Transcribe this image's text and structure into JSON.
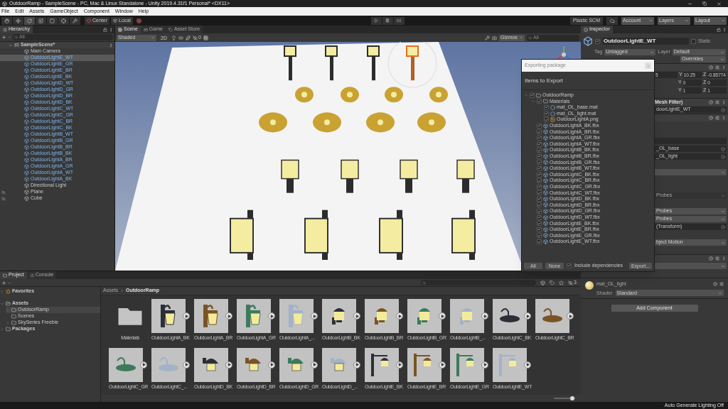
{
  "window": {
    "title": "OutdoorRamp - SampleScene - PC, Mac & Linux Standalone - Unity 2019.4.31f1 Personal* <DX11>"
  },
  "menu": [
    "File",
    "Edit",
    "Assets",
    "GameObject",
    "Component",
    "Window",
    "Help"
  ],
  "toolbar": {
    "pivot": "Center",
    "space": "Local",
    "plastic": "Plastic SCM",
    "account": "Account",
    "layers": "Layers",
    "layout": "Layout"
  },
  "hierarchy": {
    "title": "Hierarchy",
    "search": {
      "placeholder": "All"
    },
    "scene": {
      "label": "SampleScene*",
      "expanded": true
    },
    "items": [
      {
        "label": "Main Camera",
        "kind": "object",
        "selected": false,
        "hidden": false
      },
      {
        "label": "OutdoorLightE_WT",
        "kind": "prefab",
        "selected": true,
        "hidden": false
      },
      {
        "label": "OutdoorLightE_GR",
        "kind": "prefab",
        "selected": false,
        "hidden": false
      },
      {
        "label": "OutdoorLightE_BR",
        "kind": "prefab",
        "selected": false,
        "hidden": false
      },
      {
        "label": "OutdoorLightE_BK",
        "kind": "prefab",
        "selected": false,
        "hidden": false
      },
      {
        "label": "OutdoorLightD_WT",
        "kind": "prefab",
        "selected": false,
        "hidden": false
      },
      {
        "label": "OutdoorLightD_GR",
        "kind": "prefab",
        "selected": false,
        "hidden": false
      },
      {
        "label": "OutdoorLightD_BR",
        "kind": "prefab",
        "selected": false,
        "hidden": false
      },
      {
        "label": "OutdoorLightD_BK",
        "kind": "prefab",
        "selected": false,
        "hidden": false
      },
      {
        "label": "OutdoorLightC_WT",
        "kind": "prefab",
        "selected": false,
        "hidden": false
      },
      {
        "label": "OutdoorLightC_GR",
        "kind": "prefab",
        "selected": false,
        "hidden": false
      },
      {
        "label": "OutdoorLightC_BR",
        "kind": "prefab",
        "selected": false,
        "hidden": false
      },
      {
        "label": "OutdoorLightC_BK",
        "kind": "prefab",
        "selected": false,
        "hidden": false
      },
      {
        "label": "OutdoorLightB_WT",
        "kind": "prefab",
        "selected": false,
        "hidden": false
      },
      {
        "label": "OutdoorLightB_GR",
        "kind": "prefab",
        "selected": false,
        "hidden": false
      },
      {
        "label": "OutdoorLightB_BR",
        "kind": "prefab",
        "selected": false,
        "hidden": false
      },
      {
        "label": "OutdoorLightB_BK",
        "kind": "prefab",
        "selected": false,
        "hidden": false
      },
      {
        "label": "OutdoorLightA_BR",
        "kind": "prefab",
        "selected": false,
        "hidden": false
      },
      {
        "label": "OutdoorLightA_GR",
        "kind": "prefab",
        "selected": false,
        "hidden": false
      },
      {
        "label": "OutdoorLightA_WT",
        "kind": "prefab",
        "selected": false,
        "hidden": false
      },
      {
        "label": "OutdoorLightA_BK",
        "kind": "prefab",
        "selected": false,
        "hidden": false
      },
      {
        "label": "Directional Light",
        "kind": "object",
        "selected": false,
        "hidden": false
      },
      {
        "label": "Plane",
        "kind": "object",
        "selected": false,
        "hidden": true
      },
      {
        "label": "Cube",
        "kind": "object",
        "selected": false,
        "hidden": true
      }
    ]
  },
  "scene_view": {
    "tabs": [
      {
        "label": "Scene",
        "selected": true
      },
      {
        "label": "Game",
        "selected": false
      },
      {
        "label": "Asset Store",
        "selected": false
      }
    ],
    "shading": "Shaded",
    "mode_2d": "2D",
    "hidden_count": "0",
    "gizmos": "Gizmos",
    "search": {
      "placeholder": "All"
    }
  },
  "export_dialog": {
    "title": "Exporting package",
    "heading": "Items to Export",
    "tree": [
      {
        "label": "OutdoorRamp",
        "kind": "folder",
        "checked": true,
        "expanded": true,
        "children": [
          {
            "label": "Materials",
            "kind": "folder",
            "checked": true,
            "expanded": true,
            "children": [
              {
                "label": "mat_OL_base.mat",
                "kind": "material",
                "checked": true
              },
              {
                "label": "mat_OL_light.mat",
                "kind": "material",
                "checked": true
              },
              {
                "label": "OutdoorLightA.png",
                "kind": "texture",
                "checked": true
              }
            ]
          },
          {
            "label": "OutdoorLightA_BK.fbx",
            "kind": "model",
            "checked": true
          },
          {
            "label": "OutdoorLightA_BR.fbx",
            "kind": "model",
            "checked": true
          },
          {
            "label": "OutdoorLightA_GR.fbx",
            "kind": "model",
            "checked": true
          },
          {
            "label": "OutdoorLightA_WT.fbx",
            "kind": "model",
            "checked": true
          },
          {
            "label": "OutdoorLightB_BK.fbx",
            "kind": "model",
            "checked": true
          },
          {
            "label": "OutdoorLightB_BR.fbx",
            "kind": "model",
            "checked": true
          },
          {
            "label": "OutdoorLightB_GR.fbx",
            "kind": "model",
            "checked": true
          },
          {
            "label": "OutdoorLightB_WT.fbx",
            "kind": "model",
            "checked": true
          },
          {
            "label": "OutdoorLightC_BK.fbx",
            "kind": "model",
            "checked": true
          },
          {
            "label": "OutdoorLightC_BR.fbx",
            "kind": "model",
            "checked": true
          },
          {
            "label": "OutdoorLightC_GR.fbx",
            "kind": "model",
            "checked": true
          },
          {
            "label": "OutdoorLightC_WT.fbx",
            "kind": "model",
            "checked": true
          },
          {
            "label": "OutdoorLightD_BK.fbx",
            "kind": "model",
            "checked": true
          },
          {
            "label": "OutdoorLightD_BR.fbx",
            "kind": "model",
            "checked": true
          },
          {
            "label": "OutdoorLightD_GR.fbx",
            "kind": "model",
            "checked": true
          },
          {
            "label": "OutdoorLightD_WT.fbx",
            "kind": "model",
            "checked": true
          },
          {
            "label": "OutdoorLightE_BK.fbx",
            "kind": "model",
            "checked": true
          },
          {
            "label": "OutdoorLightE_BR.fbx",
            "kind": "model",
            "checked": true
          },
          {
            "label": "OutdoorLightE_GR.fbx",
            "kind": "model",
            "checked": true
          },
          {
            "label": "OutdoorLightE_WT.fbx",
            "kind": "model",
            "checked": true
          }
        ]
      }
    ],
    "all": "All",
    "none": "None",
    "include_dependencies": {
      "label": "Include dependencies",
      "checked": true
    },
    "export": "Export..."
  },
  "inspector": {
    "title": "Inspector",
    "object": {
      "name": "OutdoorLightE_WT",
      "active": true,
      "static_label": "Static",
      "static": false
    },
    "tag_label": "Tag",
    "tag": "Untagged",
    "layer_label": "Layer",
    "layer": "Default",
    "overrides": "Overrides",
    "transform": [
      [
        {
          "value": "5"
        },
        {
          "label": "Y",
          "value": "10.25"
        },
        {
          "label": "Z",
          "value": "-0.85774"
        }
      ],
      [
        {
          "label": "Y",
          "value": "0"
        },
        {
          "label": "Z",
          "value": "0"
        }
      ],
      [
        {
          "label": "Y",
          "value": "1"
        },
        {
          "label": "Z",
          "value": "1"
        }
      ]
    ],
    "rows": [
      {
        "kind": "header",
        "text": "Mesh Filter)"
      },
      {
        "kind": "object",
        "text": "doorLightE_WT"
      },
      {
        "kind": "header"
      },
      {
        "kind": "gap"
      },
      {
        "kind": "gap"
      },
      {
        "kind": "bar"
      },
      {
        "kind": "object",
        "text": "_OL_base"
      },
      {
        "kind": "object",
        "text": "_OL_light"
      },
      {
        "kind": "gap"
      },
      {
        "kind": "dropdown",
        "disabled": false
      },
      {
        "kind": "gap"
      },
      {
        "kind": "gap"
      },
      {
        "kind": "dropdown",
        "text": "Probes",
        "disabled": true
      },
      {
        "kind": "gap"
      },
      {
        "kind": "dropdown",
        "text": "Probes",
        "disabled": false
      },
      {
        "kind": "dropdown",
        "text": "Probes",
        "disabled": false
      },
      {
        "kind": "object",
        "text": "(Transform)"
      },
      {
        "kind": "gap"
      },
      {
        "kind": "dropdown",
        "text": "bject Motion",
        "disabled": false
      },
      {
        "kind": "gap"
      },
      {
        "kind": "header"
      },
      {
        "kind": "dropdown",
        "disabled": false
      }
    ],
    "material": {
      "name": "mat_OL_light",
      "shader_label": "Shader",
      "shader": "Standard"
    },
    "add_component": "Add Component"
  },
  "project": {
    "tabs": [
      {
        "label": "Project",
        "selected": true
      },
      {
        "label": "Console",
        "selected": false
      }
    ],
    "tree": [
      {
        "label": "Favorites",
        "kind": "favorites",
        "expanded": false,
        "selected": false
      },
      {
        "label": "Assets",
        "kind": "root",
        "expanded": true,
        "selected": false,
        "children": [
          {
            "label": "OutdoorRamp",
            "kind": "folder",
            "expanded": false,
            "selected": true
          },
          {
            "label": "Scenes",
            "kind": "folder",
            "selected": false
          },
          {
            "label": "SkySeries Freebie",
            "kind": "folder",
            "expanded": false,
            "selected": false
          }
        ]
      },
      {
        "label": "Packages",
        "kind": "root",
        "expanded": false,
        "selected": false
      }
    ],
    "breadcrumb": [
      "Assets",
      "OutdoorRamp"
    ],
    "hidden_count": "3",
    "zoom": {
      "level": 0.88
    },
    "assets": [
      {
        "label": "Materials",
        "kind": "folder"
      },
      {
        "label": "OutdoorLightA_BK",
        "kind": "lantern",
        "color": "#2b3038"
      },
      {
        "label": "OutdoorLightA_BR",
        "kind": "lantern",
        "color": "#7a5426"
      },
      {
        "label": "OutdoorLightA_GR",
        "kind": "lantern",
        "color": "#3d7a5c"
      },
      {
        "label": "OutdoorLightA_...",
        "kind": "lantern",
        "color": "#a3b2c8"
      },
      {
        "label": "OutdoorLightB_BK",
        "kind": "capped",
        "color": "#2b3038"
      },
      {
        "label": "OutdoorLightB_BR",
        "kind": "capped",
        "color": "#7a5426"
      },
      {
        "label": "OutdoorLightB_GR",
        "kind": "capped",
        "color": "#3d7a5c"
      },
      {
        "label": "OutdoorLightB_...",
        "kind": "capped",
        "color": "#a3b2c8"
      },
      {
        "label": "OutdoorLightC_BK",
        "kind": "dish",
        "color": "#2b3038"
      },
      {
        "label": "OutdoorLightC_BR",
        "kind": "dish",
        "color": "#7a5426"
      },
      {
        "label": "OutdoorLightC_GR",
        "kind": "dish",
        "color": "#3d7a5c"
      },
      {
        "label": "OutdoorLightC_...",
        "kind": "dish",
        "color": "#a3b2c8"
      },
      {
        "label": "OutdoorLightD_BK",
        "kind": "caged",
        "color": "#2b3038"
      },
      {
        "label": "OutdoorLightD_BR",
        "kind": "caged",
        "color": "#7a5426"
      },
      {
        "label": "OutdoorLightD_GR",
        "kind": "caged",
        "color": "#3d7a5c"
      },
      {
        "label": "OutdoorLightD_...",
        "kind": "caged",
        "color": "#a3b2c8"
      },
      {
        "label": "OutdoorLightE_BK",
        "kind": "hanging",
        "color": "#2b3038"
      },
      {
        "label": "OutdoorLightE_BR",
        "kind": "hanging",
        "color": "#7a5426"
      },
      {
        "label": "OutdoorLightE_GR",
        "kind": "hanging",
        "color": "#3d7a5c"
      },
      {
        "label": "OutdoorLightE_WT",
        "kind": "hanging",
        "color": "#a3b2c8"
      }
    ]
  },
  "status_bar": "Auto Generate Lighting Off"
}
